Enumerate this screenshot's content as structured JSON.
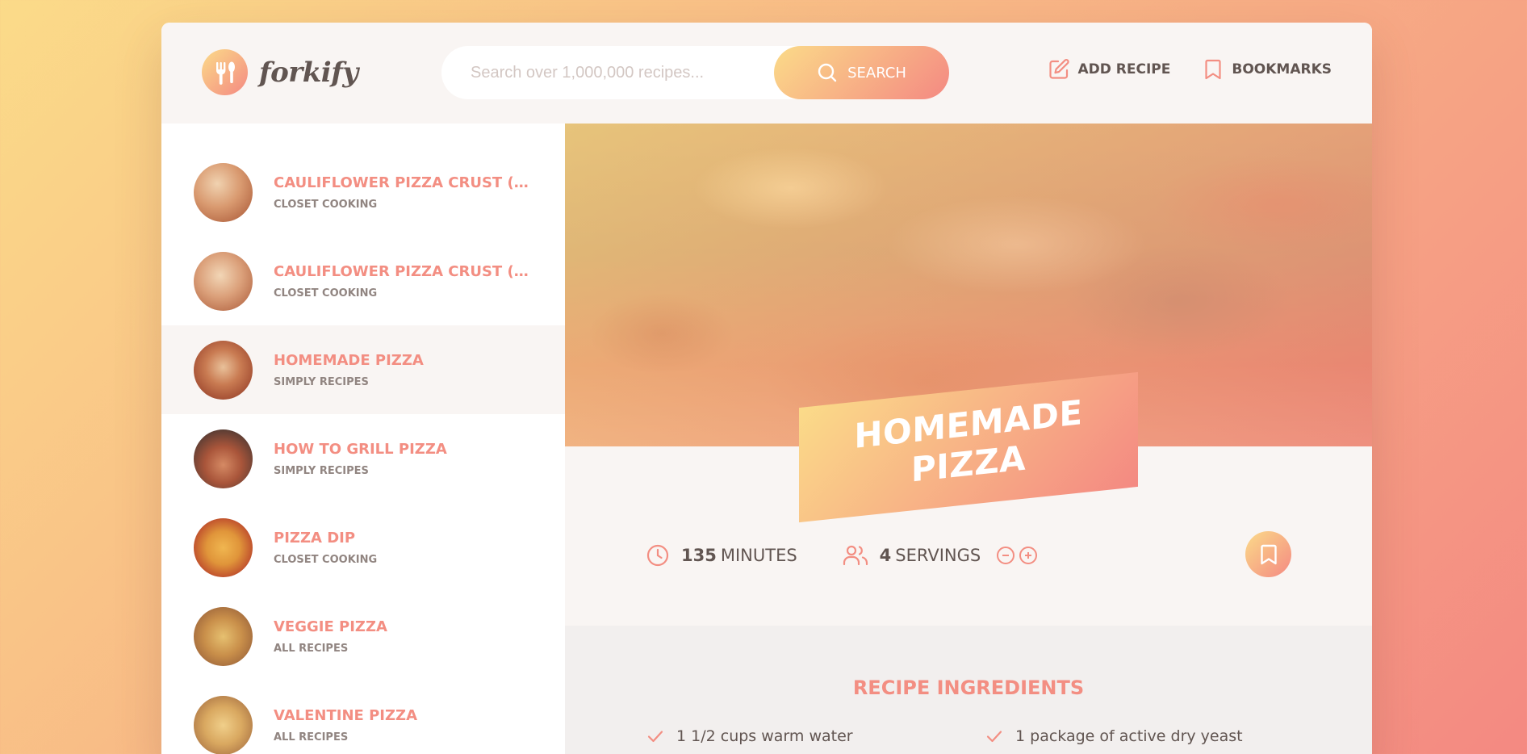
{
  "header": {
    "logo_text": "forkify",
    "search": {
      "placeholder": "Search over 1,000,000 recipes...",
      "button_label": "SEARCH"
    },
    "nav": [
      {
        "label": "ADD RECIPE",
        "icon": "edit-icon"
      },
      {
        "label": "BOOKMARKS",
        "icon": "bookmark-icon"
      }
    ]
  },
  "results": [
    {
      "title": "CAULIFLOWER PIZZA CRUST (WIT...",
      "publisher": "CLOSET COOKING"
    },
    {
      "title": "CAULIFLOWER PIZZA CRUST (WIT...",
      "publisher": "CLOSET COOKING"
    },
    {
      "title": "HOMEMADE PIZZA",
      "publisher": "SIMPLY RECIPES",
      "active": true
    },
    {
      "title": "HOW TO GRILL PIZZA",
      "publisher": "SIMPLY RECIPES"
    },
    {
      "title": "PIZZA DIP",
      "publisher": "CLOSET COOKING"
    },
    {
      "title": "VEGGIE PIZZA",
      "publisher": "ALL RECIPES"
    },
    {
      "title": "VALENTINE PIZZA",
      "publisher": "ALL RECIPES"
    }
  ],
  "recipe": {
    "title": "HOMEMADE PIZZA",
    "minutes": "135",
    "minutes_label": "MINUTES",
    "servings": "4",
    "servings_label": "SERVINGS",
    "ingredients_heading": "RECIPE INGREDIENTS",
    "ingredients": [
      "1 1/2 cups warm water",
      "1 package of active dry yeast"
    ]
  },
  "colors": {
    "accent": "#f38e82",
    "gradient_start": "#fbdb89",
    "gradient_end": "#f48982",
    "text": "#615551"
  }
}
